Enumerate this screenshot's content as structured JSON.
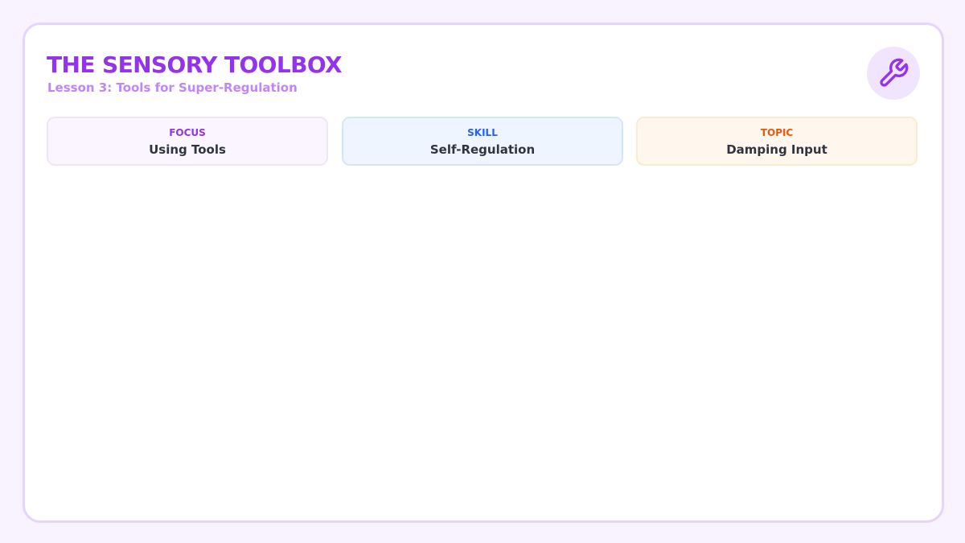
{
  "header": {
    "title": "THE SENSORY TOOLBOX",
    "subtitle": "Lesson 3: Tools for Super-Regulation",
    "icon": "wrench-icon"
  },
  "cards": [
    {
      "label": "FOCUS",
      "value": "Using Tools",
      "accent": "#9333ea"
    },
    {
      "label": "SKILL",
      "value": "Self-Regulation",
      "accent": "#2563eb"
    },
    {
      "label": "TOPIC",
      "value": "Damping Input",
      "accent": "#ea580c"
    }
  ],
  "colors": {
    "page_background": "#f8f3fe",
    "title": "#9333ea",
    "subtitle": "#c084fc",
    "frame_border": "#e5d4fb"
  }
}
